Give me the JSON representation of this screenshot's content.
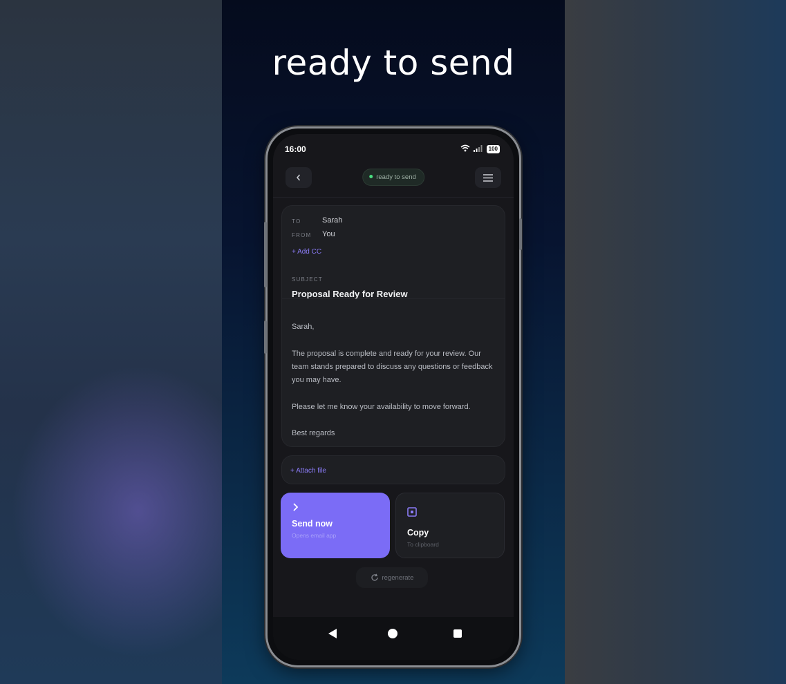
{
  "hero": {
    "title": "ready to send"
  },
  "status_bar": {
    "time": "16:00",
    "battery": "100"
  },
  "topbar": {
    "back_icon": "chevron-left-icon",
    "status_pill": "ready to send",
    "menu_icon": "hamburger-menu-icon",
    "pill_dot_color": "#4ade80"
  },
  "email": {
    "to_label": "TO",
    "to_value": "Sarah",
    "from_label": "FROM",
    "from_value": "You",
    "add_cc": "+ Add CC",
    "subject_label": "SUBJECT",
    "subject": "Proposal Ready for Review",
    "body": "Sarah,\n\nThe proposal is complete and ready for your review. Our team stands prepared to discuss any questions or feedback you may have.\n\nPlease let me know your availability to move forward.\n\nBest regards"
  },
  "attach": {
    "label": "+ Attach file"
  },
  "actions": {
    "send": {
      "icon": "chevron-right-icon",
      "title": "Send now",
      "subtitle": "Opens email app"
    },
    "copy": {
      "icon": "copy-icon",
      "title": "Copy",
      "subtitle": "To clipboard"
    }
  },
  "regenerate": {
    "icon": "refresh-icon",
    "label": "regenerate"
  },
  "colors": {
    "accent": "#7b6cf6",
    "link": "#8b7cf7"
  }
}
